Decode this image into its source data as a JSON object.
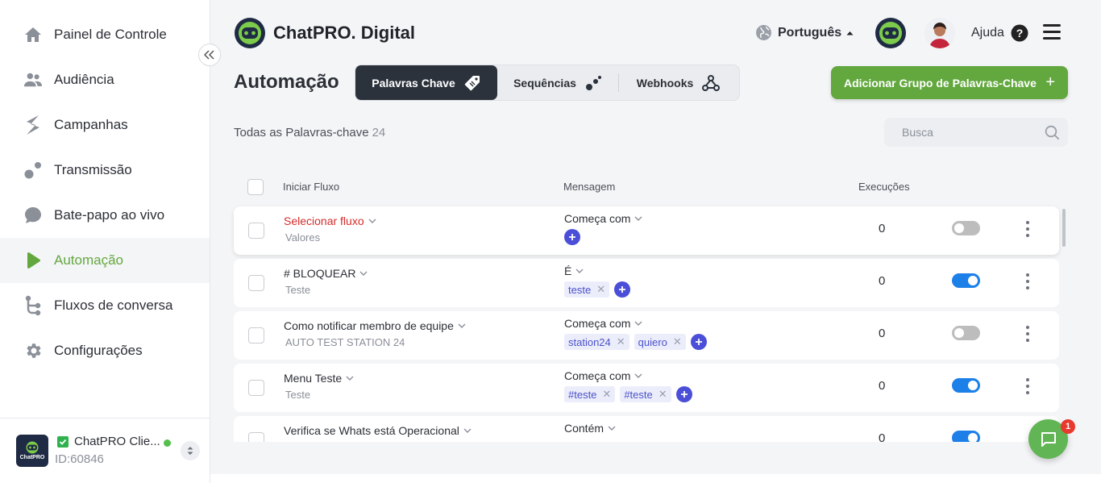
{
  "sidebar": {
    "items": [
      {
        "label": "Painel de Controle",
        "icon": "home-icon"
      },
      {
        "label": "Audiência",
        "icon": "users-icon"
      },
      {
        "label": "Campanhas",
        "icon": "campaign-icon"
      },
      {
        "label": "Transmissão",
        "icon": "broadcast-icon"
      },
      {
        "label": "Bate-papo ao vivo",
        "icon": "chat-bubble-icon"
      },
      {
        "label": "Automação",
        "icon": "play-icon"
      },
      {
        "label": "Fluxos de conversa",
        "icon": "flow-icon"
      },
      {
        "label": "Configurações",
        "icon": "gear-icon"
      }
    ],
    "active_label": "Automação",
    "account": {
      "name": "ChatPRO Clie...",
      "id": "ID:60846",
      "avatar_text": "ChatPRO"
    }
  },
  "header": {
    "brand": "ChatPRO. Digital",
    "language": "Português",
    "help": "Ajuda"
  },
  "page": {
    "title": "Automação",
    "tabs": [
      {
        "label": "Palavras Chave",
        "icon": "tag-icon"
      },
      {
        "label": "Sequências",
        "icon": "sequence-icon"
      },
      {
        "label": "Webhooks",
        "icon": "webhook-icon"
      }
    ],
    "add_button": "Adicionar Grupo de Palavras-Chave",
    "count_label": "Todas as Palavras-chave",
    "count_value": "24",
    "search_placeholder": "Busca"
  },
  "table": {
    "headers": {
      "flow": "Iniciar Fluxo",
      "message": "Mensagem",
      "executions": "Execuções"
    },
    "rows": [
      {
        "flow": "Selecionar fluxo",
        "sub": "Valores",
        "match": "Começa com",
        "chips": [],
        "exec": "0",
        "enabled": false
      },
      {
        "flow": "# BLOQUEAR",
        "sub": "Teste",
        "match": "É",
        "chips": [
          "teste"
        ],
        "exec": "0",
        "enabled": true
      },
      {
        "flow": "Como notificar membro de equipe",
        "sub": "AUTO TEST STATION 24",
        "match": "Começa com",
        "chips": [
          "station24",
          "quiero"
        ],
        "exec": "0",
        "enabled": false
      },
      {
        "flow": "Menu Teste",
        "sub": "Teste",
        "match": "Começa com",
        "chips": [
          "#teste",
          "#teste"
        ],
        "exec": "0",
        "enabled": true
      },
      {
        "flow": "Verifica se Whats está Operacional",
        "sub": "",
        "match": "Contém",
        "chips": [],
        "exec": "0",
        "enabled": true
      }
    ]
  },
  "chat_widget": {
    "badge": "1"
  },
  "colors": {
    "accent_green": "#62a83e",
    "toggle_on": "#1d7fe8",
    "chip_text": "#4c52c9",
    "danger": "#d42c2c"
  }
}
